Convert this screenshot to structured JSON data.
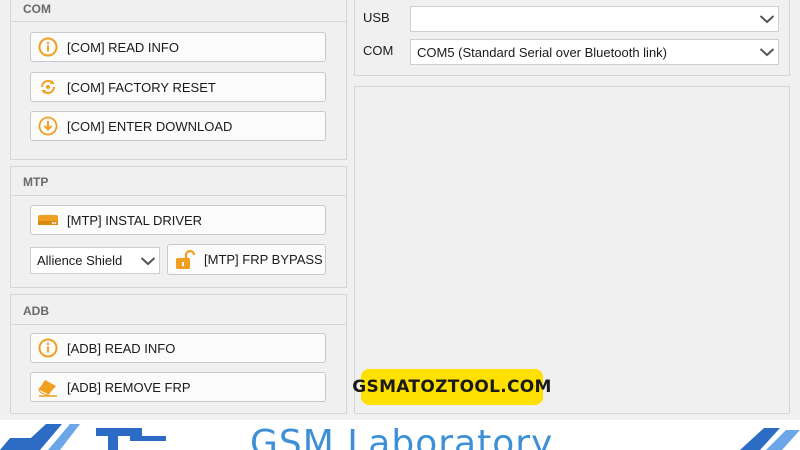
{
  "com_group": {
    "title": "COM",
    "buttons": [
      {
        "label": "[COM] READ INFO",
        "icon": "info-icon"
      },
      {
        "label": "[COM] FACTORY RESET",
        "icon": "reset-icon"
      },
      {
        "label": "[COM] ENTER DOWNLOAD",
        "icon": "download-icon"
      }
    ]
  },
  "mtp_group": {
    "title": "MTP",
    "install_driver_label": "[MTP] INSTAL DRIVER",
    "shield_select_value": "Allience Shield",
    "frp_bypass_label": "[MTP] FRP BYPASS"
  },
  "adb_group": {
    "title": "ADB",
    "read_info_label": "[ADB] READ INFO",
    "remove_frp_label": "[ADB] REMOVE FRP"
  },
  "connection": {
    "usb_label": "USB",
    "usb_value": "",
    "com_label": "COM",
    "com_value": "COM5 (Standard Serial over Bluetooth link)"
  },
  "watermark": {
    "text": "GSMATOZTOOL.COM",
    "color": "#ffe000"
  },
  "banner": {
    "text": "GSM Laboratory",
    "text_color": "#3d8fd6",
    "accent_color": "#2c6cc4"
  },
  "colors": {
    "icon_orange": "#f0a020",
    "background": "#f0f0f0"
  }
}
